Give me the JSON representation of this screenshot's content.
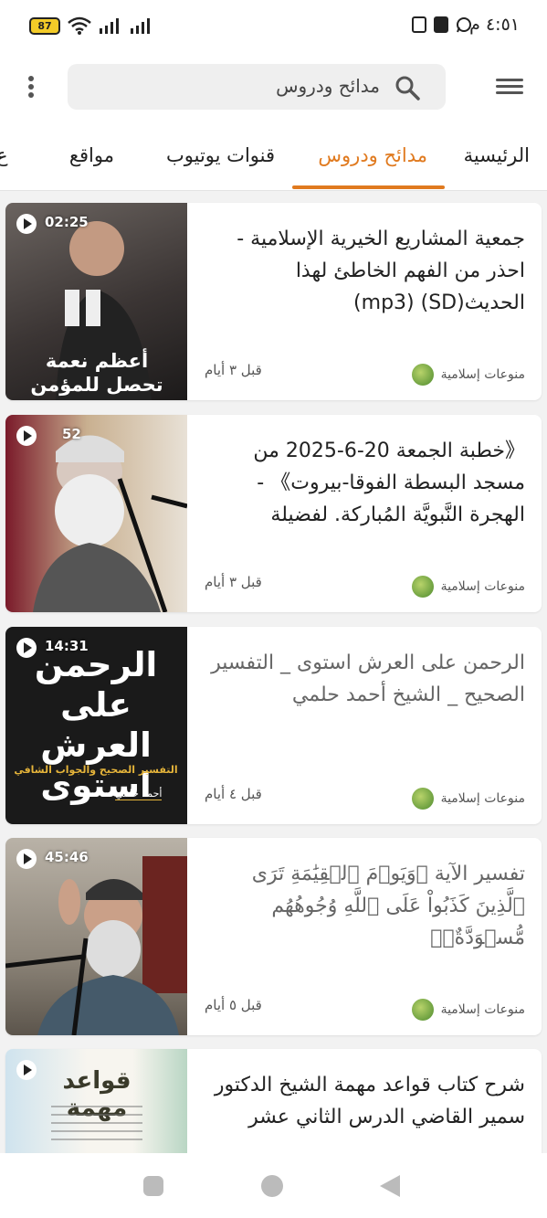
{
  "status": {
    "time": "٤:٥١ م",
    "battery": "87"
  },
  "search": {
    "text": "مدائح ودروس"
  },
  "tabs": [
    {
      "label": "الرئيسية"
    },
    {
      "label": "مدائح ودروس"
    },
    {
      "label": "قنوات يوتيوب"
    },
    {
      "label": "مواقع"
    },
    {
      "label": "ع"
    }
  ],
  "videos": [
    {
      "duration": "02:25",
      "thumb_text": "أعظم نعمة تحصل للمؤمن",
      "title": "جمعية المشاريع الخيرية الإسلامية - احذر من الفهم الخاطئ لهذا الحديث(SD) (mp3)",
      "channel": "منوعات إسلامية",
      "age": "قبل ٣ أيام"
    },
    {
      "duration": "52",
      "title": "《خطبة الجمعة 20-6-2025 من مسجد البسطة الفوقا-بيروت》 - الهجرة النَّبويَّة المُباركة. لفضيلة",
      "channel": "منوعات إسلامية",
      "age": "قبل ٣ أيام"
    },
    {
      "duration": "14:31",
      "thumb_text": "الرحمن على العرش استوى",
      "thumb_sub": "التفسير الصحيح والجواب الشافي",
      "thumb_name": "أحمد حلمي",
      "title": "الرحمن على العرش استوى _ التفسير الصحيح _ الشيخ أحمد حلمي",
      "channel": "منوعات إسلامية",
      "age": "قبل ٤ أيام"
    },
    {
      "duration": "45:46",
      "title": "تفسير الآية ﴿وَيَوۡمَ ٱلۡقِيَٰمَةِ تَرَى ٱلَّذِينَ كَذَبُواْ عَلَى ٱللَّهِ وُجُوهُهُم مُّسۡوَدَّةٌۚ﴾",
      "channel": "منوعات إسلامية",
      "age": "قبل ٥ أيام"
    },
    {
      "duration": "",
      "thumb_text": "قواعد مهمة",
      "title": "شرح كتاب قواعد مهمة الشيخ الدكتور سمير القاضي الدرس الثاني عشر",
      "channel": "",
      "age": ""
    }
  ]
}
